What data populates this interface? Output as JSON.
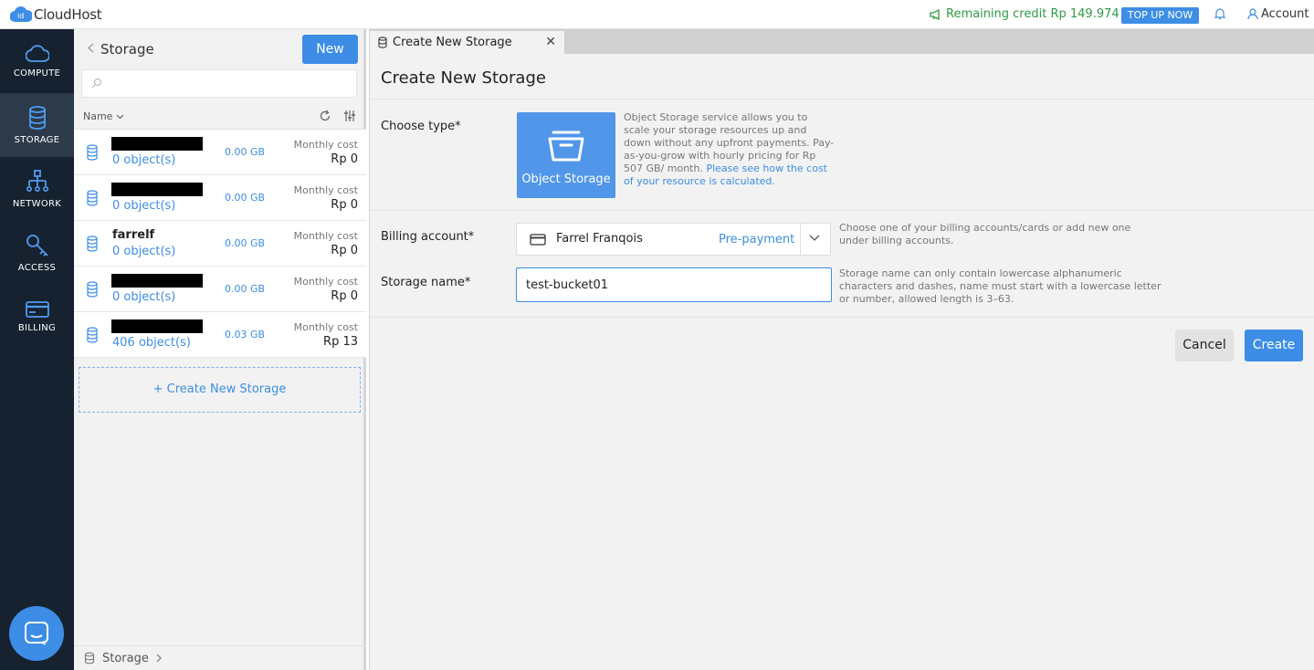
{
  "app": {
    "logo_badge": "id",
    "logo_text": "CloudHost"
  },
  "topbar": {
    "credit_text": "Remaining credit Rp 149.974",
    "topup_label": "TOP UP NOW",
    "account_label": "Account"
  },
  "nav": {
    "items": [
      {
        "label": "COMPUTE",
        "icon": "cloud-icon"
      },
      {
        "label": "STORAGE",
        "icon": "database-icon",
        "active": true
      },
      {
        "label": "NETWORK",
        "icon": "network-icon"
      },
      {
        "label": "ACCESS",
        "icon": "key-icon"
      },
      {
        "label": "BILLING",
        "icon": "card-icon"
      }
    ]
  },
  "list": {
    "title": "Storage",
    "new_label": "New",
    "search_placeholder": "",
    "col_name": "Name",
    "rows": [
      {
        "name": "",
        "redacted": true,
        "objects": "0 object(s)",
        "size": "0.00 GB",
        "cost_label": "Monthly cost",
        "cost": "Rp 0"
      },
      {
        "name": "",
        "redacted": true,
        "objects": "0 object(s)",
        "size": "0.00 GB",
        "cost_label": "Monthly cost",
        "cost": "Rp 0"
      },
      {
        "name": "farrelf",
        "redacted": false,
        "objects": "0 object(s)",
        "size": "0.00 GB",
        "cost_label": "Monthly cost",
        "cost": "Rp 0"
      },
      {
        "name": "",
        "redacted": true,
        "objects": "0 object(s)",
        "size": "0.00 GB",
        "cost_label": "Monthly cost",
        "cost": "Rp 0"
      },
      {
        "name": "",
        "redacted": true,
        "objects": "406 object(s)",
        "size": "0.03 GB",
        "cost_label": "Monthly cost",
        "cost": "Rp 13"
      }
    ],
    "create_new_label": "+ Create New Storage",
    "footer_label": "Storage"
  },
  "form": {
    "tab_label": "Create New Storage",
    "title": "Create New Storage",
    "type_label": "Choose type*",
    "tile_label": "Object Storage",
    "tile_desc": "Object Storage service allows you to scale your storage resources up and down without any upfront payments. Pay-as-you-grow with hourly pricing for Rp 507 GB/ month.",
    "tile_link": "Please see how the cost of your resource is calculated.",
    "billing_label": "Billing account*",
    "billing_name": "Farrel Franqois",
    "billing_mode": "Pre-payment",
    "billing_hint": "Choose one of your billing accounts/cards or add new one under billing accounts.",
    "name_label": "Storage name*",
    "name_value": "test-bucket01",
    "name_hint": "Storage name can only contain lowercase alphanumeric characters and dashes, name must start with a lowercase letter or number, allowed length is 3–63.",
    "cancel_label": "Cancel",
    "create_label": "Create"
  },
  "colors": {
    "accent": "#3d8de6",
    "nav_bg": "#162230",
    "credit": "#2e9b48"
  }
}
